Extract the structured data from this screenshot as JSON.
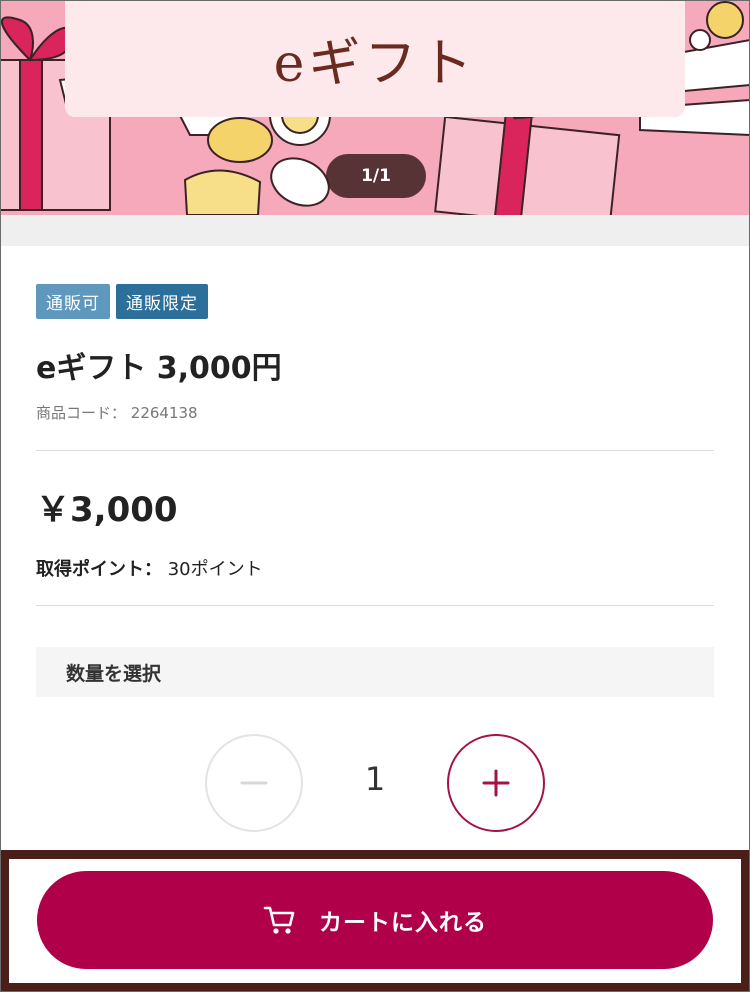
{
  "hero": {
    "title": "eギフト",
    "slide_counter": "1/1"
  },
  "badges": [
    "通販可",
    "通販限定"
  ],
  "product": {
    "name": "eギフト 3,000円",
    "code_label": "商品コード：",
    "code_value": "2264138",
    "price": "￥3,000",
    "points_label": "取得ポイント：",
    "points_value": "30ポイント"
  },
  "quantity": {
    "header": "数量を選択",
    "value": "1"
  },
  "cart": {
    "button_label": "カートに入れる",
    "icon": "cart-icon"
  },
  "colors": {
    "accent": "#b0004a",
    "hero_bg": "#f5a9bb",
    "badge_light": "#5e98bd",
    "badge_dark": "#2b6f9a"
  }
}
